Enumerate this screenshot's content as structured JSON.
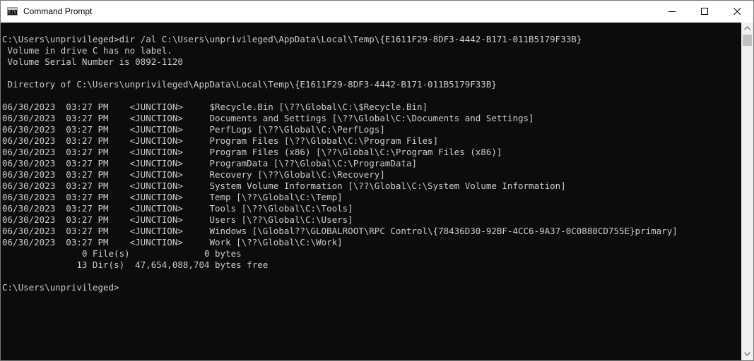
{
  "window": {
    "title": "Command Prompt",
    "icon_text": "C:\\",
    "icon": "cmd-icon"
  },
  "caption_buttons": {
    "minimize_icon": "minimize-icon",
    "maximize_icon": "maximize-icon",
    "close_icon": "close-icon"
  },
  "console": {
    "lines": [
      "C:\\Users\\unprivileged>dir /al C:\\Users\\unprivileged\\AppData\\Local\\Temp\\{E1611F29-8DF3-4442-B171-011B5179F33B}",
      " Volume in drive C has no label.",
      " Volume Serial Number is 0892-1120",
      "",
      " Directory of C:\\Users\\unprivileged\\AppData\\Local\\Temp\\{E1611F29-8DF3-4442-B171-011B5179F33B}",
      "",
      "06/30/2023  03:27 PM    <JUNCTION>     $Recycle.Bin [\\??\\Global\\C:\\$Recycle.Bin]",
      "06/30/2023  03:27 PM    <JUNCTION>     Documents and Settings [\\??\\Global\\C:\\Documents and Settings]",
      "06/30/2023  03:27 PM    <JUNCTION>     PerfLogs [\\??\\Global\\C:\\PerfLogs]",
      "06/30/2023  03:27 PM    <JUNCTION>     Program Files [\\??\\Global\\C:\\Program Files]",
      "06/30/2023  03:27 PM    <JUNCTION>     Program Files (x86) [\\??\\Global\\C:\\Program Files (x86)]",
      "06/30/2023  03:27 PM    <JUNCTION>     ProgramData [\\??\\Global\\C:\\ProgramData]",
      "06/30/2023  03:27 PM    <JUNCTION>     Recovery [\\??\\Global\\C:\\Recovery]",
      "06/30/2023  03:27 PM    <JUNCTION>     System Volume Information [\\??\\Global\\C:\\System Volume Information]",
      "06/30/2023  03:27 PM    <JUNCTION>     Temp [\\??\\Global\\C:\\Temp]",
      "06/30/2023  03:27 PM    <JUNCTION>     Tools [\\??\\Global\\C:\\Tools]",
      "06/30/2023  03:27 PM    <JUNCTION>     Users [\\??\\Global\\C:\\Users]",
      "06/30/2023  03:27 PM    <JUNCTION>     Windows [\\Global??\\GLOBALROOT\\RPC Control\\{78436D30-92BF-4CC6-9A37-0C0880CD755E}primary]",
      "06/30/2023  03:27 PM    <JUNCTION>     Work [\\??\\Global\\C:\\Work]",
      "               0 File(s)              0 bytes",
      "              13 Dir(s)  47,654,088,704 bytes free",
      "",
      "C:\\Users\\unprivileged>"
    ]
  },
  "scrollbar": {
    "up_icon": "scroll-up-arrow-icon",
    "down_icon": "scroll-down-arrow-icon"
  },
  "colors": {
    "console_background": "#0c0c0c",
    "console_text": "#cccccc",
    "titlebar_background": "#ffffff",
    "scrollbar_background": "#f0f0f0"
  }
}
